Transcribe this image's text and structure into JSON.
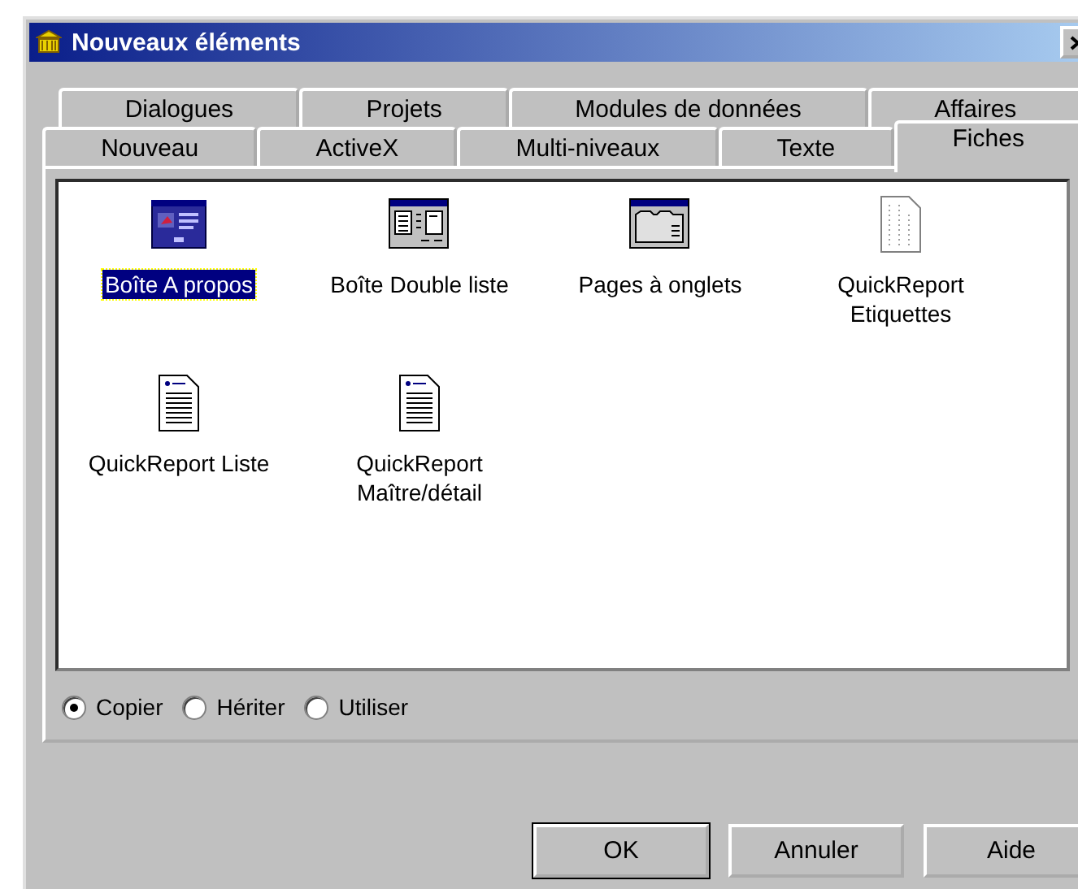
{
  "window": {
    "title": "Nouveaux éléments"
  },
  "tab_rows": [
    [
      {
        "label": "Dialogues",
        "selected": false
      },
      {
        "label": "Projets",
        "selected": false
      },
      {
        "label": "Modules de données",
        "selected": false
      },
      {
        "label": "Affaires",
        "selected": false
      }
    ],
    [
      {
        "label": "Nouveau",
        "selected": false
      },
      {
        "label": "ActiveX",
        "selected": false
      },
      {
        "label": "Multi-niveaux",
        "selected": false
      },
      {
        "label": "Texte",
        "selected": false
      },
      {
        "label": "Fiches",
        "selected": true
      }
    ]
  ],
  "items": [
    {
      "label": "Boîte A propos",
      "kind": "about",
      "selected": true
    },
    {
      "label": "Boîte Double liste",
      "kind": "duallist",
      "selected": false
    },
    {
      "label": "Pages à onglets",
      "kind": "tabbed",
      "selected": false
    },
    {
      "label": "QuickReport Etiquettes",
      "kind": "labels",
      "selected": false
    },
    {
      "label": "QuickReport Liste",
      "kind": "report",
      "selected": false
    },
    {
      "label": "QuickReport Maître/détail",
      "kind": "report",
      "selected": false
    }
  ],
  "options": [
    {
      "label": "Copier",
      "selected": true
    },
    {
      "label": "Hériter",
      "selected": false
    },
    {
      "label": "Utiliser",
      "selected": false
    }
  ],
  "buttons": [
    {
      "label": "OK",
      "default": true
    },
    {
      "label": "Annuler",
      "default": false
    },
    {
      "label": "Aide",
      "default": false
    }
  ]
}
